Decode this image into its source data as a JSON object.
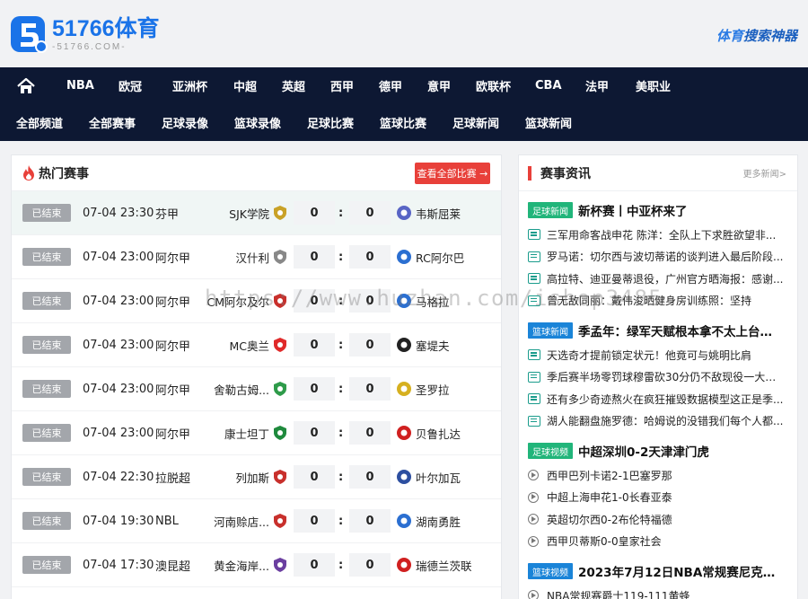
{
  "header": {
    "logo_main": "51766",
    "logo_suffix": "体育",
    "logo_sub": "-51766.COM-",
    "slogan_em": "体育",
    "slogan_rest": "搜索神器"
  },
  "nav": {
    "row1": [
      "NBA",
      "欧冠",
      "亚洲杯",
      "中超",
      "英超",
      "西甲",
      "德甲",
      "意甲",
      "欧联杯",
      "CBA",
      "法甲",
      "美职业"
    ],
    "row2": [
      "全部频道",
      "全部赛事",
      "足球录像",
      "篮球录像",
      "足球比赛",
      "篮球比赛",
      "足球新闻",
      "篮球新闻"
    ]
  },
  "hot": {
    "title": "热门赛事",
    "all_button": "查看全部比赛 →",
    "matches": [
      {
        "status": "已结束",
        "time": "07-04 23:30",
        "league": "芬甲",
        "home": "SJK学院",
        "hs": "0",
        "as": "0",
        "away": "韦斯屈莱",
        "hcolor": "#c9a227",
        "acolor": "#5865c5"
      },
      {
        "status": "已结束",
        "time": "07-04 23:00",
        "league": "阿尔甲",
        "home": "汉什利",
        "hs": "0",
        "as": "0",
        "away": "RC阿尔巴",
        "hcolor": "#888888",
        "acolor": "#2b6fd1"
      },
      {
        "status": "已结束",
        "time": "07-04 23:00",
        "league": "阿尔甲",
        "home": "CM阿尔及尔",
        "hs": "0",
        "as": "0",
        "away": "马格拉",
        "hcolor": "#c8302c",
        "acolor": "#2b6fd1"
      },
      {
        "status": "已结束",
        "time": "07-04 23:00",
        "league": "阿尔甲",
        "home": "MC奥兰",
        "hs": "0",
        "as": "0",
        "away": "塞堤夫",
        "hcolor": "#e02a2a",
        "acolor": "#222222"
      },
      {
        "status": "已结束",
        "time": "07-04 23:00",
        "league": "阿尔甲",
        "home": "舍勒古姆...",
        "hs": "0",
        "as": "0",
        "away": "圣罗拉",
        "hcolor": "#2e9b4a",
        "acolor": "#d6b020"
      },
      {
        "status": "已结束",
        "time": "07-04 23:00",
        "league": "阿尔甲",
        "home": "康士坦丁",
        "hs": "0",
        "as": "0",
        "away": "贝鲁扎达",
        "hcolor": "#1f8a3d",
        "acolor": "#d02020"
      },
      {
        "status": "已结束",
        "time": "07-04 22:30",
        "league": "拉脱超",
        "home": "列加斯",
        "hs": "0",
        "as": "0",
        "away": "叶尔加瓦",
        "hcolor": "#c8302c",
        "acolor": "#2d4fa0"
      },
      {
        "status": "已结束",
        "time": "07-04 19:30",
        "league": "NBL",
        "home": "河南赊店...",
        "hs": "0",
        "as": "0",
        "away": "湖南勇胜",
        "hcolor": "#c8302c",
        "acolor": "#2b6fd1"
      },
      {
        "status": "已结束",
        "time": "07-04 17:30",
        "league": "澳昆超",
        "home": "黄金海岸...",
        "hs": "0",
        "as": "0",
        "away": "瑞德兰茨联",
        "hcolor": "#6b3fa0",
        "acolor": "#d02020"
      }
    ]
  },
  "news": {
    "title": "赛事资讯",
    "more": "更多新闻>",
    "sections": [
      {
        "tag": "足球新闻",
        "tagcolor": "green",
        "headline": "新杯赛丨中亚杯来了",
        "kind": "news",
        "items": [
          "三军用命客战申花 陈洋：全队上下求胜欲望非...",
          "罗马诺：切尔西与波切蒂诺的谈判进入最后阶段...",
          "高拉特、迪亚曼蒂退役，广州官方晒海报：感谢...",
          "曾无敌同丽：戴伟浚晒健身房训练照：坚持"
        ]
      },
      {
        "tag": "篮球新闻",
        "tagcolor": "blue",
        "headline": "季孟年：绿军天赋根本拿不太上台面...",
        "kind": "news",
        "items": [
          "天选奇才提前锁定状元！他竟可与姚明比肩",
          "季后赛半场零罚球穆雷砍30分仍不敌现役一大神...",
          "还有多少奇迹熬火在疯狂摧毁数据模型这正是季...",
          "湖人能翻盘施罗德：哈姆说的没错我们每个人都..."
        ]
      },
      {
        "tag": "足球视频",
        "tagcolor": "green",
        "headline": "中超深圳0-2天津津门虎",
        "kind": "video",
        "items": [
          "西甲巴列卡诺2-1巴塞罗那",
          "中超上海申花1-0长春亚泰",
          "英超切尔西0-2布伦特福德",
          "西甲贝蒂斯0-0皇家社会"
        ]
      },
      {
        "tag": "篮球视频",
        "tagcolor": "blue",
        "headline": "2023年7月12日NBA常规赛尼克斯...",
        "kind": "video",
        "items": [
          "NBA常规赛爵士119-111黄蜂"
        ]
      }
    ]
  },
  "watermark": "https://www.huzhan.com/ishop3485"
}
